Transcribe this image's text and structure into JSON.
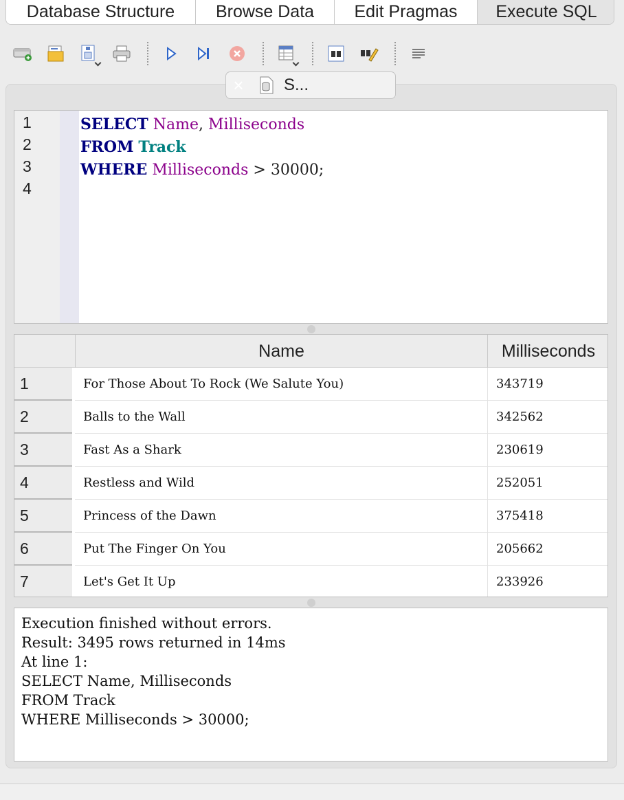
{
  "tabs": [
    {
      "label": "Database Structure"
    },
    {
      "label": "Browse Data"
    },
    {
      "label": "Edit Pragmas"
    },
    {
      "label": "Execute SQL"
    }
  ],
  "toolbar": {
    "icons": [
      "open-tab-icon",
      "open-file-icon",
      "save-file-icon",
      "print-icon",
      "execute-all-icon",
      "execute-line-icon",
      "stop-icon",
      "save-results-icon",
      "find-icon",
      "find-replace-icon",
      "comment-icon"
    ]
  },
  "doc_tab": {
    "close": "×",
    "label": "S..."
  },
  "editor": {
    "line_numbers": [
      "1",
      "2",
      "3",
      "4"
    ],
    "lines": [
      {
        "kw": "SELECT",
        "rest_col": "Name",
        "punct": ", ",
        "rest_col2": "Milliseconds"
      },
      {
        "kw": "FROM",
        "table": "Track"
      },
      {
        "kw": "WHERE",
        "col": "Milliseconds",
        "tail": " > 30000;"
      }
    ]
  },
  "results": {
    "columns": [
      "Name",
      "Milliseconds"
    ],
    "rows": [
      {
        "num": "1",
        "name": "For Those About To Rock (We Salute You)",
        "ms": "343719"
      },
      {
        "num": "2",
        "name": "Balls to the Wall",
        "ms": "342562"
      },
      {
        "num": "3",
        "name": "Fast As a Shark",
        "ms": "230619"
      },
      {
        "num": "4",
        "name": "Restless and Wild",
        "ms": "252051"
      },
      {
        "num": "5",
        "name": "Princess of the Dawn",
        "ms": "375418"
      },
      {
        "num": "6",
        "name": "Put The Finger On You",
        "ms": "205662"
      },
      {
        "num": "7",
        "name": "Let's Get It Up",
        "ms": "233926"
      }
    ]
  },
  "message": {
    "lines": [
      "Execution finished without errors.",
      "Result: 3495 rows returned in 14ms",
      "At line 1:",
      "SELECT Name, Milliseconds",
      "FROM Track",
      "WHERE Milliseconds > 30000;"
    ]
  },
  "colors": {
    "keyword": "#00007f",
    "column": "#8b008b",
    "table": "#008080"
  }
}
